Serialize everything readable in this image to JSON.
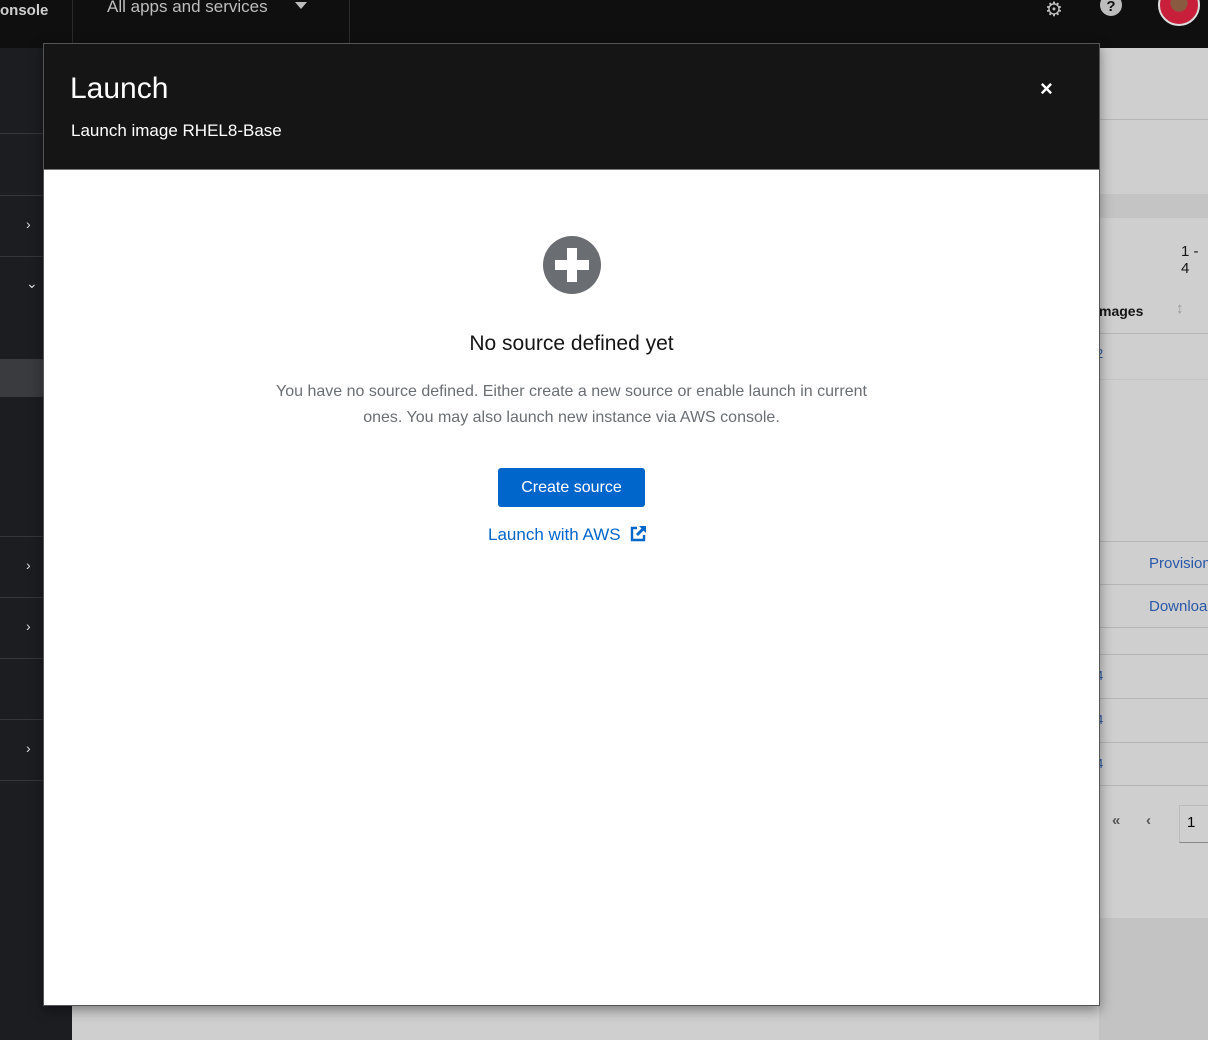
{
  "topbar": {
    "brand": "onsole",
    "app_selector": "All apps and services"
  },
  "background": {
    "range": "1 - 4",
    "column_header": "mages",
    "row_link_1": "2",
    "action_1": "Provision",
    "action_2": "Downloa",
    "links": [
      "4",
      "4",
      "4"
    ],
    "page": "1"
  },
  "modal": {
    "title": "Launch",
    "subtitle": "Launch image RHEL8-Base",
    "close": "×",
    "empty_title": "No source defined yet",
    "empty_body": "You have no source defined. Either create a new source or enable launch in current ones. You may also launch new instance via AWS console.",
    "create_button": "Create source",
    "aws_link": "Launch with AWS"
  }
}
